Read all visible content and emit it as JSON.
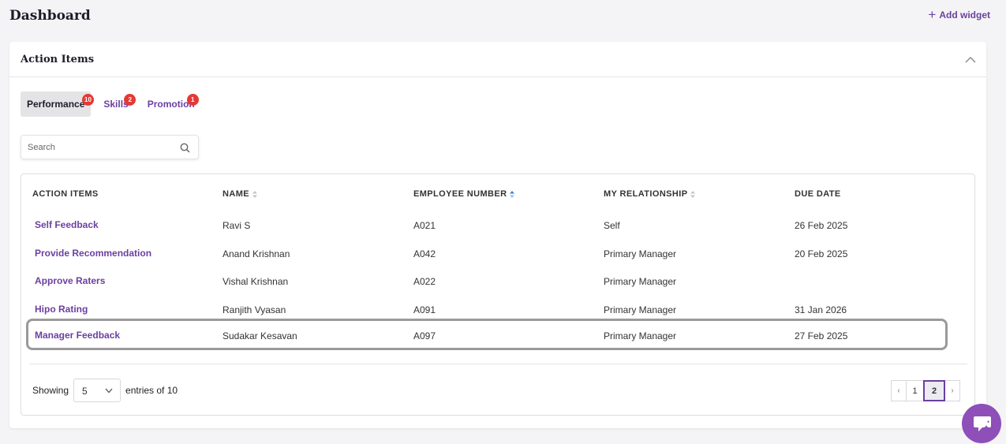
{
  "page": {
    "title": "Dashboard",
    "add_widget_label": "Add widget"
  },
  "card": {
    "title": "Action Items"
  },
  "tabs": [
    {
      "label": "Performance",
      "count": "10",
      "active": true
    },
    {
      "label": "Skills",
      "count": "2",
      "active": false
    },
    {
      "label": "Promotion",
      "count": "1",
      "active": false
    }
  ],
  "search": {
    "placeholder": "Search",
    "value": ""
  },
  "table": {
    "headers": [
      "ACTION ITEMS",
      "NAME",
      "EMPLOYEE NUMBER",
      "MY RELATIONSHIP",
      "DUE DATE"
    ],
    "rows": [
      {
        "action": "Self Feedback",
        "name": "Ravi S",
        "emp": "A021",
        "relationship": "Self",
        "due": "26 Feb 2025"
      },
      {
        "action": "Provide Recommendation",
        "name": "Anand Krishnan",
        "emp": "A042",
        "relationship": "Primary Manager",
        "due": "20 Feb 2025"
      },
      {
        "action": "Approve Raters",
        "name": "Vishal Krishnan",
        "emp": "A022",
        "relationship": "Primary Manager",
        "due": ""
      },
      {
        "action": "Hipo Rating",
        "name": "Ranjith Vyasan",
        "emp": "A091",
        "relationship": "Primary Manager",
        "due": "31 Jan 2026"
      },
      {
        "action": "Manager Feedback",
        "name": "Sudakar Kesavan",
        "emp": "A097",
        "relationship": "Primary Manager",
        "due": "27 Feb 2025"
      }
    ]
  },
  "footer": {
    "showing_label": "Showing",
    "page_size": "5",
    "entries_label": "entries of 10",
    "pages": [
      "1",
      "2"
    ],
    "current_page": "2",
    "prev_symbol": "‹",
    "next_symbol": "›"
  },
  "colors": {
    "accent": "#6b3fa0",
    "badge": "#e53935",
    "fab": "#8e4fb9"
  }
}
